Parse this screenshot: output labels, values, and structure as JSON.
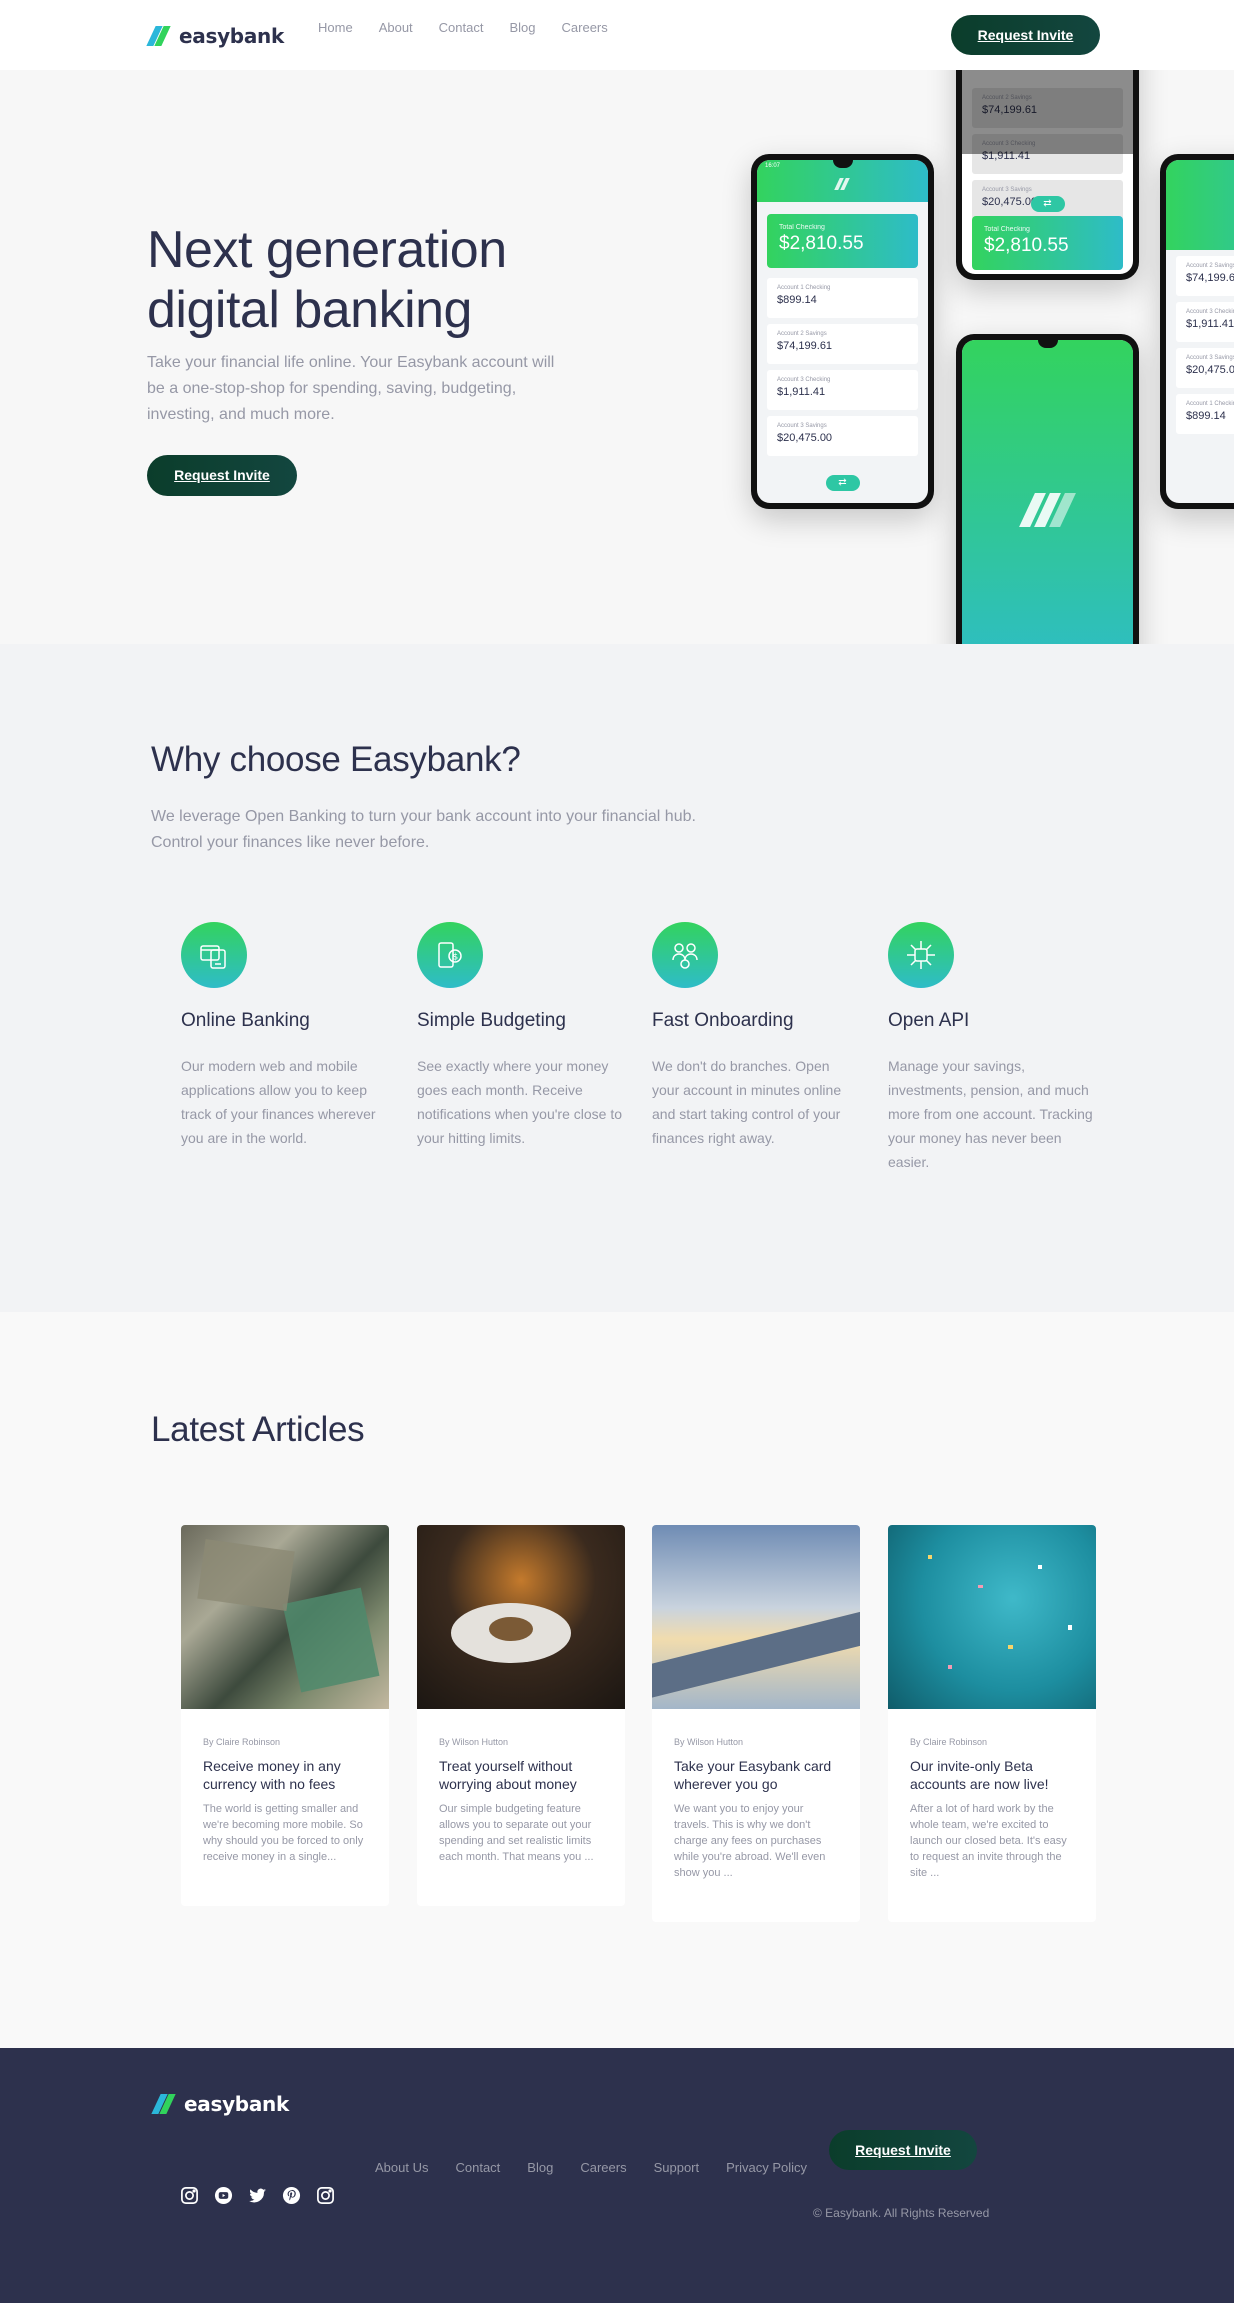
{
  "brand": {
    "name": "easybank",
    "colors": {
      "dark_blue": "#2d314d",
      "lime_green": "#31d35c",
      "bright_cyan": "#2bb7da",
      "button_dark": "#0b3d2b",
      "grayish_blue": "#9698a6"
    }
  },
  "header": {
    "nav": [
      "Home",
      "About",
      "Contact",
      "Blog",
      "Careers"
    ],
    "cta": "Request Invite"
  },
  "hero": {
    "title": "Next generation digital banking",
    "description": "Take your financial life online. Your Easybank account will be a one-stop-shop for spending, saving, budgeting, investing, and much more.",
    "cta": "Request Invite",
    "phone": {
      "total_label": "Total Checking",
      "total": "$2,810.55",
      "accounts": [
        {
          "label": "Account 1 Checking",
          "amount": "$899.14"
        },
        {
          "label": "Account 2 Savings",
          "amount": "$74,199.61"
        },
        {
          "label": "Account 3 Checking",
          "amount": "$1,911.41"
        },
        {
          "label": "Account 3 Savings",
          "amount": "$20,475.00"
        }
      ],
      "time": "16:07"
    }
  },
  "why": {
    "title": "Why choose Easybank?",
    "description": "We leverage Open Banking to turn your bank account into your financial hub. Control your finances like never before.",
    "features": [
      {
        "icon": "online-banking-icon",
        "title": "Online Banking",
        "text": "Our modern web and mobile applications allow you to keep track of your finances wherever you are in the world."
      },
      {
        "icon": "budgeting-icon",
        "title": "Simple Budgeting",
        "text": "See exactly where your money goes each month. Receive notifications when you're close to your hitting limits."
      },
      {
        "icon": "onboarding-icon",
        "title": "Fast Onboarding",
        "text": "We don't do branches. Open your account in minutes online and start taking control of your finances right away."
      },
      {
        "icon": "api-icon",
        "title": "Open API",
        "text": "Manage your savings, investments, pension, and much more from one account. Tracking your money has never been easier."
      }
    ]
  },
  "articles": {
    "title": "Latest Articles",
    "items": [
      {
        "author": "By Claire Robinson",
        "title": "Receive money in any currency with no fees",
        "excerpt": "The world is getting smaller and we're becoming more mobile. So why should you be forced to only receive money in a single..."
      },
      {
        "author": "By Wilson Hutton",
        "title": "Treat yourself without worrying about money",
        "excerpt": "Our simple budgeting feature allows you to separate out your spending and set realistic limits each month. That means you ..."
      },
      {
        "author": "By Wilson Hutton",
        "title": "Take your Easybank card wherever you go",
        "excerpt": "We want you to enjoy your travels. This is why we don't charge any fees on purchases while you're abroad. We'll even show you ..."
      },
      {
        "author": "By Claire Robinson",
        "title": "Our invite-only Beta accounts are now live!",
        "excerpt": "After a lot of hard work by the whole team, we're excited to launch our closed beta. It's easy to request an invite through the site ..."
      }
    ]
  },
  "footer": {
    "links": [
      "About Us",
      "Contact",
      "Blog",
      "Careers",
      "Support",
      "Privacy Policy"
    ],
    "cta": "Request Invite",
    "copyright": "© Easybank. All Rights Reserved",
    "social": [
      "instagram-icon",
      "youtube-icon",
      "twitter-icon",
      "pinterest-icon",
      "instagram-icon"
    ]
  }
}
